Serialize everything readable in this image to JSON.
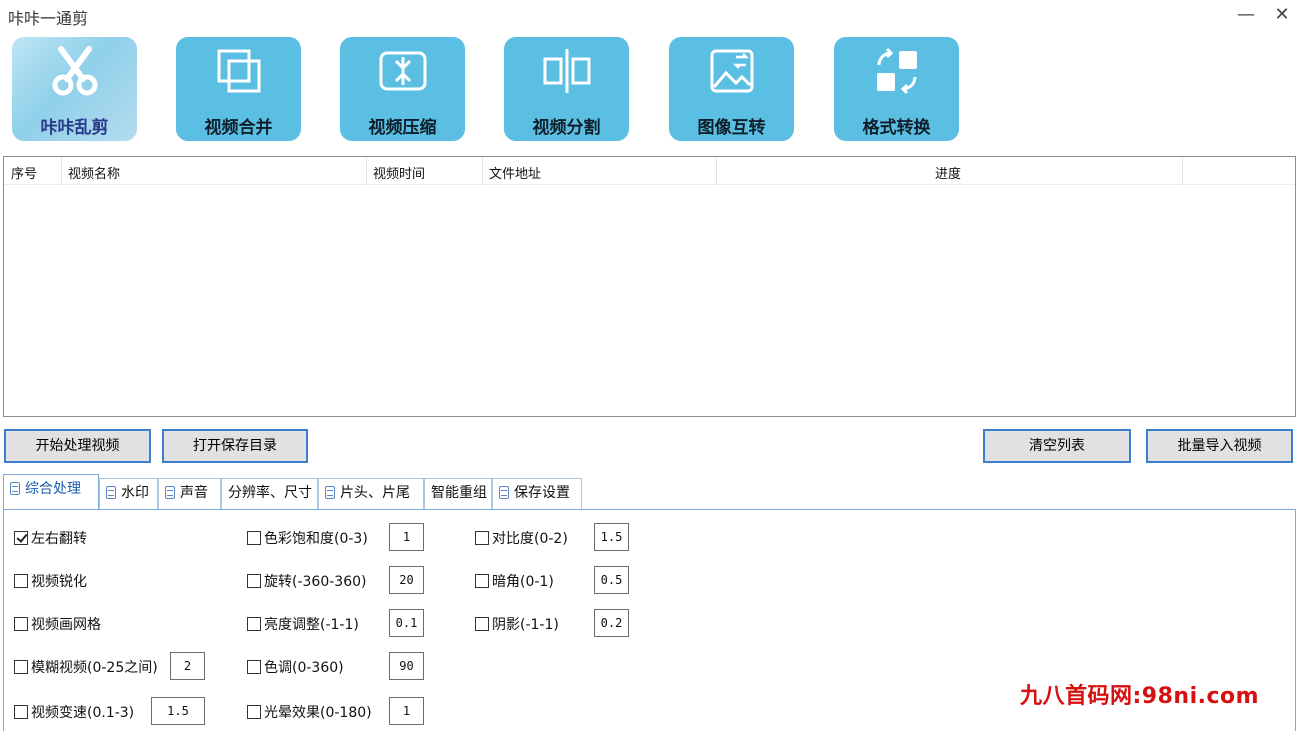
{
  "app": {
    "title": "咔咔一通剪",
    "minimize": "—",
    "close": "✕"
  },
  "toolbar": {
    "logo_label": "咔咔乱剪",
    "tiles": [
      {
        "label": "视频合并",
        "icon": "merge-icon"
      },
      {
        "label": "视频压缩",
        "icon": "compress-icon"
      },
      {
        "label": "视频分割",
        "icon": "split-icon"
      },
      {
        "label": "图像互转",
        "icon": "image-convert-icon"
      },
      {
        "label": "格式转换",
        "icon": "format-convert-icon"
      }
    ]
  },
  "table": {
    "columns": [
      "序号",
      "视频名称",
      "视频时间",
      "文件地址",
      "进度"
    ],
    "rows": []
  },
  "actions": {
    "start": "开始处理视频",
    "open_dir": "打开保存目录",
    "clear": "清空列表",
    "batch_import": "批量导入视频"
  },
  "tabs": [
    {
      "label": "综合处理",
      "active": true,
      "icon": "document-icon"
    },
    {
      "label": "水印",
      "icon": "document-icon"
    },
    {
      "label": "声音",
      "icon": "document-icon"
    },
    {
      "label": "分辨率、尺寸"
    },
    {
      "label": "片头、片尾",
      "icon": "document-icon"
    },
    {
      "label": "智能重组"
    },
    {
      "label": "保存设置",
      "icon": "document-icon"
    }
  ],
  "options": {
    "flip_lr": {
      "label": "左右翻转",
      "checked": true
    },
    "sharpen": {
      "label": "视频锐化",
      "checked": false
    },
    "grid": {
      "label": "视频画网格",
      "checked": false
    },
    "blur": {
      "label": "模糊视频(0-25之间)",
      "checked": false,
      "value": "2"
    },
    "speed": {
      "label": "视频变速(0.1-3)",
      "checked": false,
      "value": "1.5"
    },
    "saturation": {
      "label": "色彩饱和度(0-3)",
      "checked": false,
      "value": "1"
    },
    "rotate": {
      "label": "旋转(-360-360)",
      "checked": false,
      "value": "20"
    },
    "brightness": {
      "label": "亮度调整(-1-1)",
      "checked": false,
      "value": "0.1"
    },
    "hue": {
      "label": "色调(0-360)",
      "checked": false,
      "value": "90"
    },
    "halo": {
      "label": "光晕效果(0-180)",
      "checked": false,
      "value": "1"
    },
    "contrast": {
      "label": "对比度(0-2)",
      "checked": false,
      "value": "1.5"
    },
    "vignette": {
      "label": "暗角(0-1)",
      "checked": false,
      "value": "0.5"
    },
    "shadow": {
      "label": "阴影(-1-1)",
      "checked": false,
      "value": "0.2"
    }
  },
  "watermark_text": "九八首码网:98ni.com"
}
